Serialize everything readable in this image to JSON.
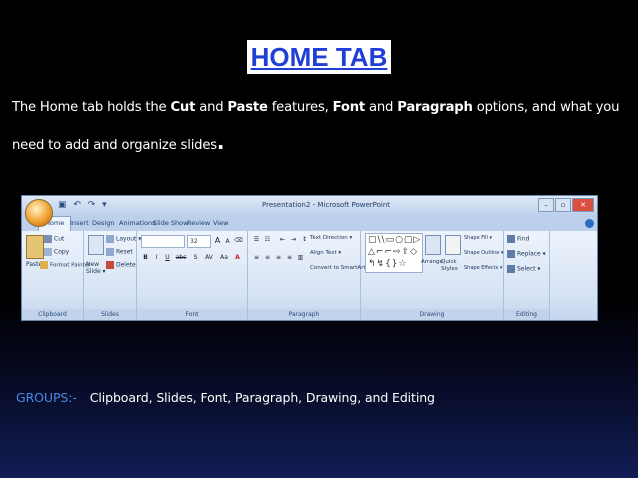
{
  "title": "HOME TAB",
  "description": {
    "t1": "The Home tab holds the ",
    "b1": "Cut",
    "t2": " and ",
    "b2": "Paste",
    "t3": " features, ",
    "b3": "Font",
    "t4": " and ",
    "b4": "Paragraph",
    "t5": " options, and what you need to add and organize slides",
    "end": "."
  },
  "ribbon": {
    "window_title": "Presentation2 - Microsoft PowerPoint",
    "qat": "▣ ↶ ↷ ▾",
    "tabs": [
      "Home",
      "Insert",
      "Design",
      "Animations",
      "Slide Show",
      "Review",
      "View"
    ],
    "clipboard": {
      "label": "Clipboard",
      "paste": "Paste",
      "cut": "Cut",
      "copy": "Copy",
      "format_painter": "Format Painter"
    },
    "slides": {
      "label": "Slides",
      "new_slide": "New Slide ▾",
      "layout": "Layout ▾",
      "reset": "Reset",
      "delete": "Delete"
    },
    "font": {
      "label": "Font",
      "size": "32",
      "grow": "A",
      "shrink": "A",
      "bold": "B",
      "italic": "I",
      "underline": "U",
      "strike": "abc",
      "shadow": "S",
      "spacing": "AV",
      "case": "Aa",
      "color": "A"
    },
    "paragraph": {
      "label": "Paragraph",
      "text_direction": "Text Direction ▾",
      "align_text": "Align Text ▾",
      "smartart": "Convert to SmartArt ▾"
    },
    "drawing": {
      "label": "Drawing",
      "shapes_row1": "▢\\\\▭○▢▷",
      "shapes_row2": "△⌐⌐⇨⇧◇",
      "shapes_row3": "↰↯{}☆",
      "arrange": "Arrange",
      "quick_styles": "Quick Styles",
      "fill": "Shape Fill ▾",
      "outline": "Shape Outline ▾",
      "effects": "Shape Effects ▾"
    },
    "editing": {
      "label": "Editing",
      "find": "Find",
      "replace": "Replace ▾",
      "select": "Select ▾"
    }
  },
  "groups": {
    "label": "GROUPS:-",
    "text": "Clipboard, Slides, Font, Paragraph, Drawing, and Editing"
  },
  "colors": {
    "title_text": "#1f3fd6",
    "groups_label": "#4a86e0"
  }
}
